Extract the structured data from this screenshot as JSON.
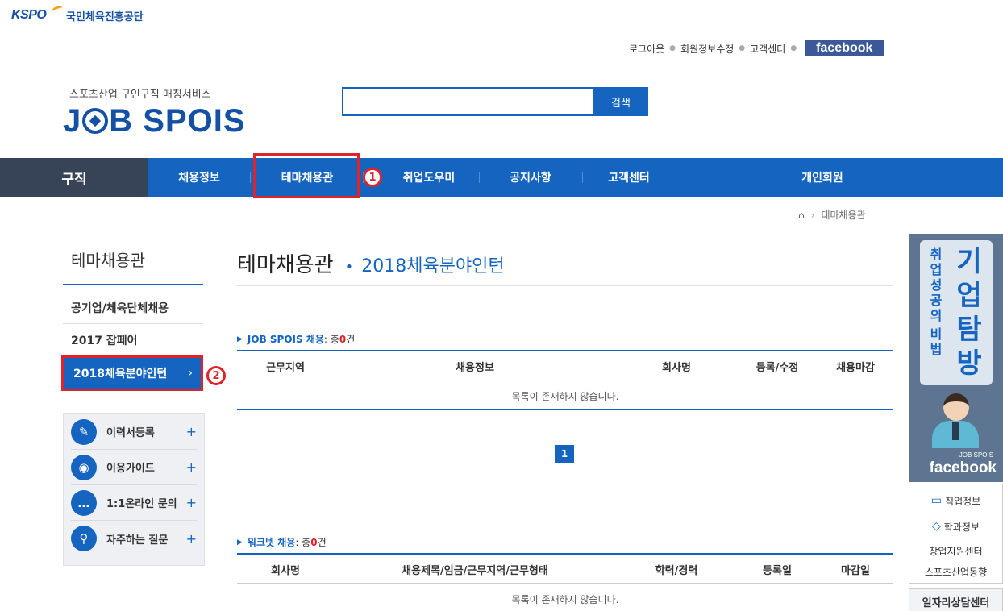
{
  "brand": {
    "org_logo": "KSPO",
    "org_name": "국민체육진흥공단"
  },
  "util": {
    "logout": "로그아웃",
    "edit_profile": "회원정보수정",
    "support": "고객센터",
    "facebook": "facebook"
  },
  "site": {
    "subtitle": "스포츠산업 구인구직 매칭서비스",
    "logo_left": "J",
    "logo_right": "B SPOIS"
  },
  "search": {
    "placeholder": "",
    "button": "검색"
  },
  "gnb": {
    "title": "구직",
    "items": [
      "채용정보",
      "테마채용관",
      "취업도우미",
      "공지사항",
      "고객센터"
    ],
    "right": "개인회원",
    "annotation_1": "1",
    "annotation_2": "2"
  },
  "breadcrumb": {
    "current": "테마채용관"
  },
  "lnb": {
    "title": "테마채용관",
    "items": [
      "공기업/체육단체채용",
      "2017 잡페어",
      "2018체육분야인턴"
    ],
    "active_arrow": "›"
  },
  "quick": [
    {
      "label": "이력서등록",
      "icon": "pencil-icon"
    },
    {
      "label": "이용가이드",
      "icon": "location-icon"
    },
    {
      "label": "1:1온라인 문의",
      "icon": "chat-icon"
    },
    {
      "label": "자주하는 질문",
      "icon": "magnifier-icon"
    }
  ],
  "main": {
    "title": "테마채용관",
    "subtitle": "2018체육분야인턴"
  },
  "section1": {
    "label": "JOB SPOIS 채용",
    "total_prefix": ": 총",
    "count": "0",
    "unit": "건",
    "columns": [
      "근무지역",
      "채용정보",
      "회사명",
      "등록/수정",
      "채용마감"
    ],
    "empty": "목록이 존재하지 않습니다."
  },
  "pagination": {
    "current": "1"
  },
  "section2": {
    "label": "워크넷 채용",
    "total_prefix": ": 총",
    "count": "0",
    "unit": "건",
    "columns": [
      "회사명",
      "채용제목/임금/근무지역/근무형태",
      "학력/경력",
      "등록일",
      "마감일"
    ],
    "empty": "목록이 존재하지 않습니다."
  },
  "banner": {
    "small_text": [
      "취",
      "업",
      "성",
      "공",
      "의",
      "비",
      "법"
    ],
    "big_text": [
      "기",
      "업",
      "탐",
      "방"
    ],
    "cap1": "JOB SPOIS",
    "cap2": "facebook"
  },
  "side_links": [
    "직업정보",
    "학과정보",
    "창업지원센터",
    "스포츠산업동향"
  ],
  "side_call": "일자리상담센터",
  "colors": {
    "primary": "#1565c0",
    "dark": "#374357",
    "highlight": "#e0232b"
  }
}
